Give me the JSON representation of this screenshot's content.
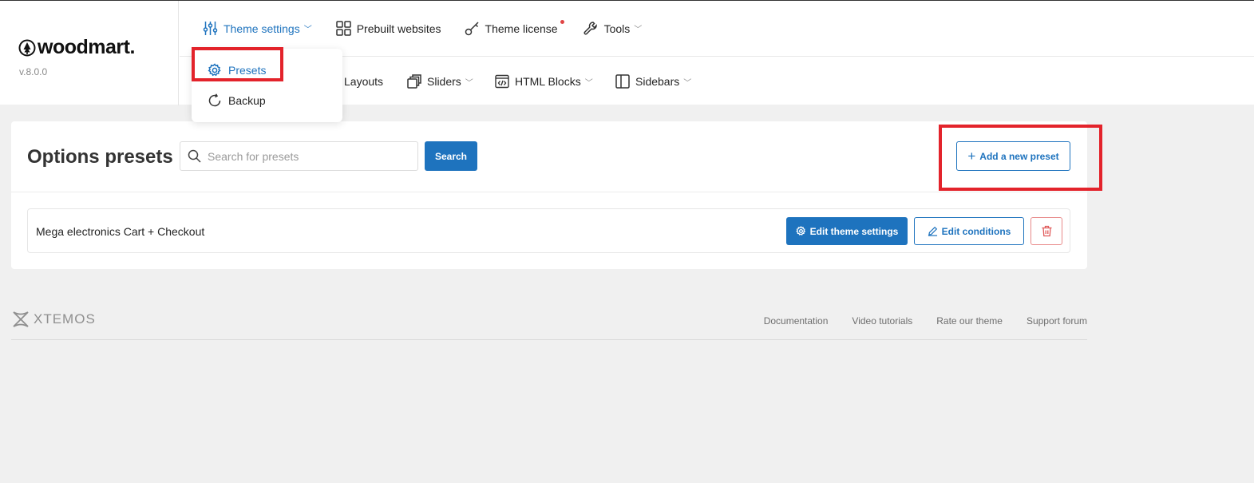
{
  "brand": {
    "logo_text": "woodmart.",
    "version": "v.8.0.0"
  },
  "nav": {
    "row1": [
      {
        "label": "Theme settings",
        "icon": "sliders-icon",
        "active": true,
        "has_dropdown": true
      },
      {
        "label": "Prebuilt websites",
        "icon": "grid-icon",
        "active": false,
        "has_dropdown": false
      },
      {
        "label": "Theme license",
        "icon": "key-icon",
        "active": false,
        "has_dropdown": false,
        "badge_dot": true
      },
      {
        "label": "Tools",
        "icon": "wrench-icon",
        "active": false,
        "has_dropdown": true
      }
    ],
    "row2": [
      {
        "label": "Layouts",
        "icon": "layout-icon",
        "has_dropdown": false
      },
      {
        "label": "Sliders",
        "icon": "slides-icon",
        "has_dropdown": true
      },
      {
        "label": "HTML Blocks",
        "icon": "code-icon",
        "has_dropdown": true
      },
      {
        "label": "Sidebars",
        "icon": "sidebar-icon",
        "has_dropdown": true
      }
    ]
  },
  "dropdown": {
    "items": [
      {
        "label": "Presets",
        "icon": "gear-icon",
        "active": true
      },
      {
        "label": "Backup",
        "icon": "refresh-icon",
        "active": false
      }
    ]
  },
  "main": {
    "title": "Options presets",
    "search_placeholder": "Search for presets",
    "search_button": "Search",
    "add_button": "Add a new preset",
    "presets": [
      {
        "name": "Mega electronics Cart + Checkout",
        "edit_theme_label": "Edit theme settings",
        "edit_conditions_label": "Edit conditions"
      }
    ]
  },
  "footer": {
    "brand": "XTEMOS",
    "links": [
      "Documentation",
      "Video tutorials",
      "Rate our theme",
      "Support forum"
    ]
  },
  "colors": {
    "accent": "#1e73be",
    "highlight": "#e3232b",
    "danger": "#e88a8a",
    "background": "#f0f0f0"
  }
}
